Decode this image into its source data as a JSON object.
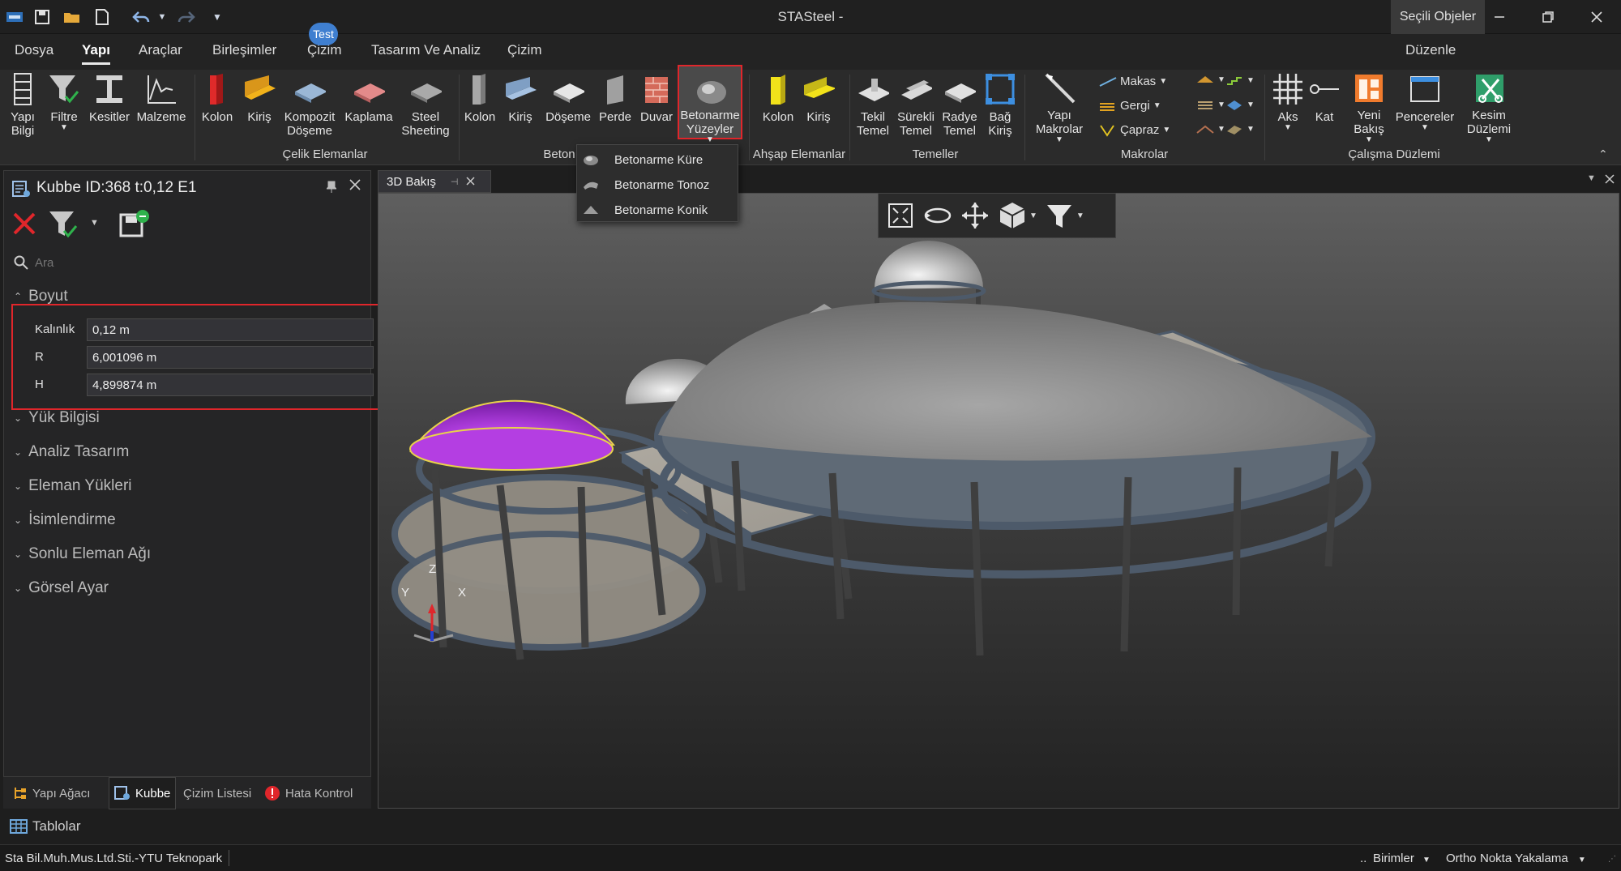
{
  "app": {
    "title": "STASteel -",
    "selected_objects": "Seçili Objeler"
  },
  "menu": {
    "items": [
      "Dosya",
      "Yapı",
      "Araçlar",
      "Birleşimler",
      "Çizim",
      "Tasarım Ve Analiz",
      "Çizim"
    ],
    "active": "Yapı",
    "badge": "Test",
    "right": "Düzenle"
  },
  "ribbon": {
    "yapi_bilgi": "Yapı\nBilgi",
    "filtre": "Filtre",
    "kesitler": "Kesitler",
    "malzeme": "Malzeme",
    "celik": {
      "group": "Çelik Elemanlar",
      "kolon": "Kolon",
      "kiris": "Kiriş",
      "kompozit": "Kompozit\nDöşeme",
      "kaplama": "Kaplama",
      "steel": "Steel\nSheeting"
    },
    "beton": {
      "group": "Beton",
      "kolon": "Kolon",
      "kiris": "Kiriş",
      "doseme": "Döşeme",
      "perde": "Perde",
      "duvar": "Duvar",
      "yuzeyler": "Betonarme\nYüzeyler"
    },
    "ahsap": {
      "group": "Ahşap Elemanlar",
      "kolon": "Kolon",
      "kiris": "Kiriş"
    },
    "temeller": {
      "group": "Temeller",
      "tekil": "Tekil\nTemel",
      "surekli": "Sürekli\nTemel",
      "radye": "Radye\nTemel",
      "bag": "Bağ\nKiriş"
    },
    "makrolar": {
      "group": "Makrolar",
      "yapi": "Yapı\nMakrolar",
      "makas": "Makas",
      "gergi": "Gergi",
      "capraz": "Çapraz"
    },
    "calisma": {
      "group": "Çalışma Düzlemi",
      "aks": "Aks",
      "kat": "Kat",
      "yeni": "Yeni\nBakış",
      "pencereler": "Pencereler",
      "kesim": "Kesim\nDüzlemi"
    }
  },
  "dropdown": {
    "items": [
      "Betonarme Küre",
      "Betonarme Tonoz",
      "Betonarme Konik"
    ]
  },
  "panel": {
    "title": "Kubbe ID:368 t:0,12 E1",
    "search_placeholder": "Ara",
    "sections": {
      "boyut": "Boyut",
      "yuk": "Yük Bilgisi",
      "analiz": "Analiz Tasarım",
      "eleman": "Eleman Yükleri",
      "isim": "İsimlendirme",
      "sonlu": "Sonlu Eleman Ağı",
      "gorsel": "Görsel Ayar"
    },
    "props": [
      {
        "label": "Kalınlık",
        "value": "0,12 m"
      },
      {
        "label": "R",
        "value": "6,001096 m"
      },
      {
        "label": "H",
        "value": "4,899874 m"
      }
    ],
    "tabs": [
      "Yapı Ağacı",
      "Kubbe",
      "Çizim Listesi",
      "Hata Kontrol"
    ]
  },
  "view": {
    "tab": "3D Bakış",
    "axes": {
      "z": "Z",
      "y": "Y",
      "x": "X"
    }
  },
  "bottom": {
    "tablolar": "Tablolar",
    "company": "Sta Bil.Muh.Mus.Ltd.Sti.-YTU Teknopark",
    "birimler": "Birimler",
    "ortho": "Ortho",
    "nokta": "Nokta Yakalama"
  },
  "colors": {
    "dome_selected": "#a030d8",
    "highlight": "#e0262b",
    "accent": "#3f7fd0"
  }
}
